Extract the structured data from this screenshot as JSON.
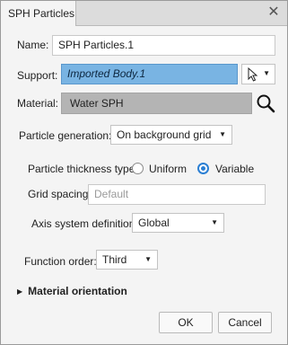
{
  "dialog": {
    "title": "SPH Particles",
    "close_glyph": "✕"
  },
  "name": {
    "label": "Name:",
    "value": "SPH Particles.1"
  },
  "support": {
    "label": "Support:",
    "value": "Imported Body.1",
    "icon": "pointer-arrow-icon"
  },
  "material": {
    "label": "Material:",
    "value": "Water SPH",
    "icon": "search-icon"
  },
  "particle_generation": {
    "label": "Particle generation:",
    "value": "On background grid"
  },
  "particle_thickness": {
    "label": "Particle thickness type:",
    "options": [
      "Uniform",
      "Variable"
    ],
    "selected": "Variable"
  },
  "grid_spacing": {
    "label": "Grid spacing:",
    "placeholder": "Default"
  },
  "axis_system": {
    "label": "Axis system definition:",
    "value": "Global"
  },
  "function_order": {
    "label": "Function order:",
    "value": "Third"
  },
  "material_orientation": {
    "label": "Material orientation",
    "expanded": false
  },
  "buttons": {
    "ok": "OK",
    "cancel": "Cancel"
  },
  "colors": {
    "support_highlight": "#79b4e3",
    "material_field": "#b4b4b4",
    "radio_selected": "#2b7fd3"
  }
}
